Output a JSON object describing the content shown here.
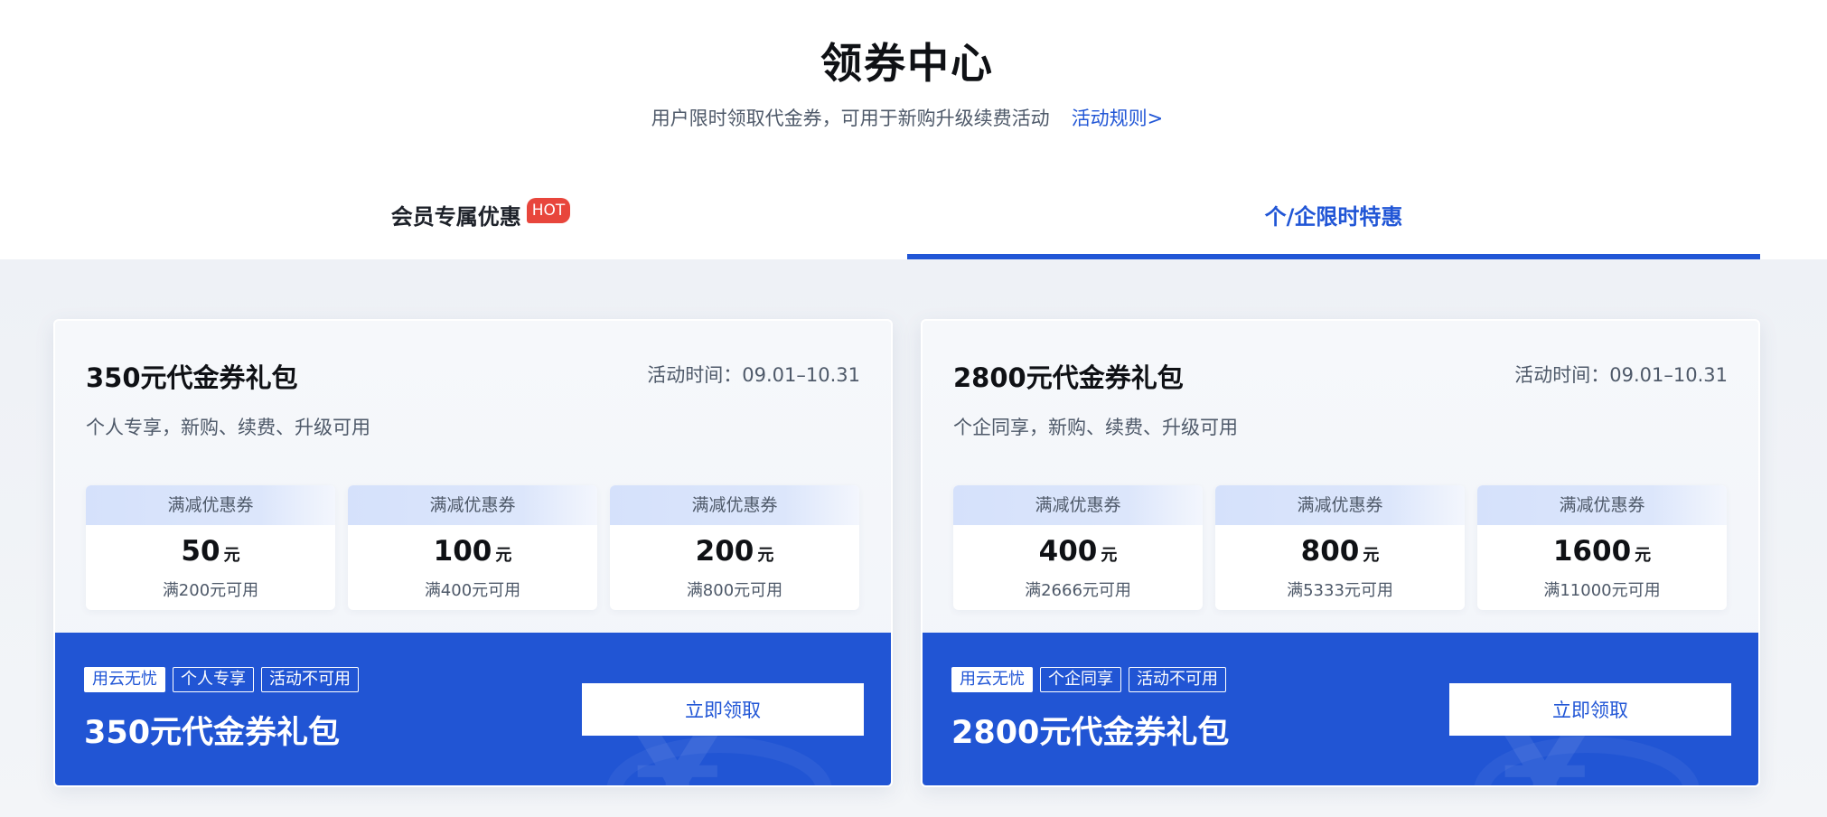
{
  "header": {
    "title": "领券中心",
    "subtitle": "用户限时领取代金券，可用于新购升级续费活动",
    "rules_link": "活动规则>"
  },
  "tabs": [
    {
      "label": "会员专属优惠",
      "badge": "HOT",
      "active": false
    },
    {
      "label": "个/企限时特惠",
      "active": true
    }
  ],
  "cards": [
    {
      "title": "350元代金券礼包",
      "period": "活动时间：09.01–10.31",
      "description": "个人专享，新购、续费、升级可用",
      "coupons": [
        {
          "type": "满减优惠券",
          "amount": "50",
          "unit": "元",
          "condition": "满200元可用"
        },
        {
          "type": "满减优惠券",
          "amount": "100",
          "unit": "元",
          "condition": "满400元可用"
        },
        {
          "type": "满减优惠券",
          "amount": "200",
          "unit": "元",
          "condition": "满800元可用"
        }
      ],
      "tags": [
        "用云无忧",
        "个人专享",
        "活动不可用"
      ],
      "footer_title": "350元代金券礼包",
      "button_label": "立即领取",
      "watermark": "¥"
    },
    {
      "title": "2800元代金券礼包",
      "period": "活动时间：09.01–10.31",
      "description": "个企同享，新购、续费、升级可用",
      "coupons": [
        {
          "type": "满减优惠券",
          "amount": "400",
          "unit": "元",
          "condition": "满2666元可用"
        },
        {
          "type": "满减优惠券",
          "amount": "800",
          "unit": "元",
          "condition": "满5333元可用"
        },
        {
          "type": "满减优惠券",
          "amount": "1600",
          "unit": "元",
          "condition": "满11000元可用"
        }
      ],
      "tags": [
        "用云无忧",
        "个企同享",
        "活动不可用"
      ],
      "footer_title": "2800元代金券礼包",
      "button_label": "立即领取",
      "watermark": "¥"
    }
  ],
  "colors": {
    "accent": "#2156d6",
    "footer_bg": "#2155d4",
    "hot_badge": "#e8463c"
  }
}
